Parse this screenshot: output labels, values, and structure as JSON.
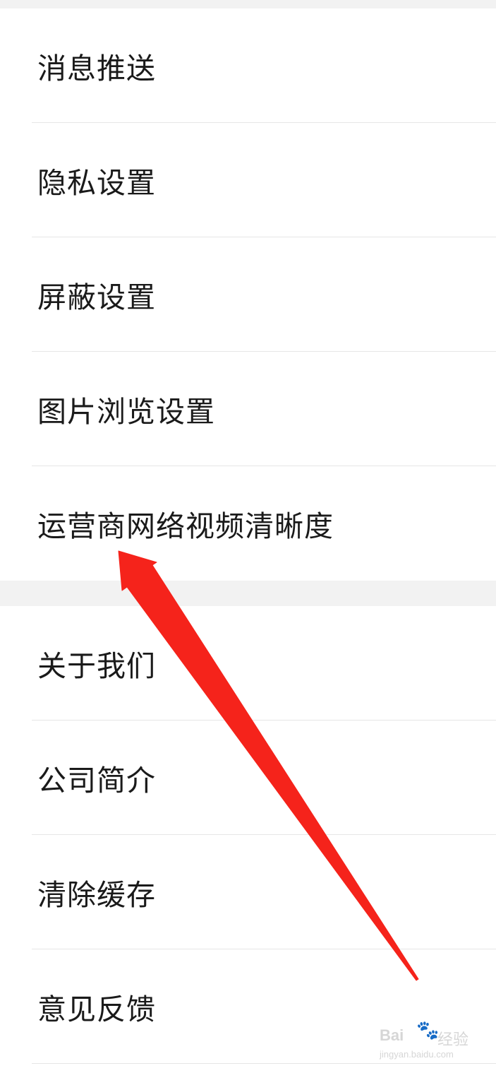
{
  "settings": {
    "group1": [
      {
        "label": "消息推送"
      },
      {
        "label": "隐私设置"
      },
      {
        "label": "屏蔽设置"
      },
      {
        "label": "图片浏览设置"
      },
      {
        "label": "运营商网络视频清晰度"
      }
    ],
    "group2": [
      {
        "label": "关于我们"
      },
      {
        "label": "公司简介"
      },
      {
        "label": "清除缓存"
      },
      {
        "label": "意见反馈"
      }
    ]
  },
  "annotation": {
    "arrow_color": "#f5231b",
    "arrow_icon": "red-arrow-pointing-up-left"
  },
  "watermark": {
    "logo_text": "Bai",
    "paw_icon": "paw-icon",
    "cn_text": "经验",
    "url": "jingyan.baidu.com"
  },
  "colors": {
    "background": "#ffffff",
    "section_gap": "#f2f2f2",
    "divider": "#e6e6e6",
    "text": "#1a1a1a"
  }
}
